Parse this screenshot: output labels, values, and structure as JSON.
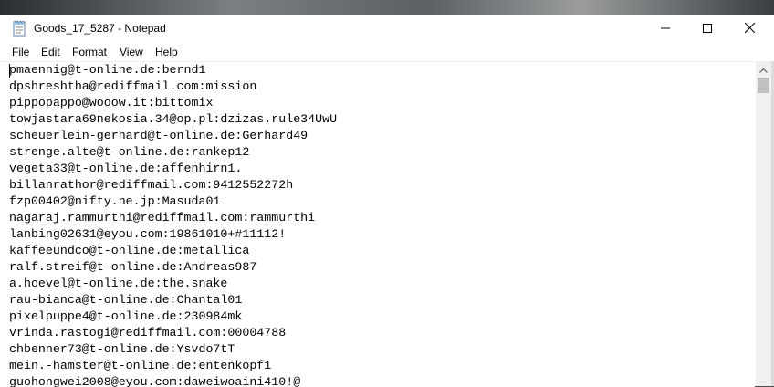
{
  "window": {
    "title": "Goods_17_5287 - Notepad",
    "icon": "notepad-icon"
  },
  "controls": {
    "minimize_icon": "minimize-icon",
    "maximize_icon": "maximize-icon",
    "close_icon": "close-icon"
  },
  "menu": {
    "items": [
      "File",
      "Edit",
      "Format",
      "View",
      "Help"
    ]
  },
  "editor": {
    "lines": [
      "pmaennig@t-online.de:bernd1",
      "dpshreshtha@rediffmail.com:mission",
      "pippopappo@wooow.it:bittomix",
      "towjastara69nekosia.34@op.pl:dzizas.rule34UwU",
      "scheuerlein-gerhard@t-online.de:Gerhard49",
      "strenge.alte@t-online.de:rankep12",
      "vegeta33@t-online.de:affenhirn1.",
      "billanrathor@rediffmail.com:9412552272h",
      "fzp00402@nifty.ne.jp:Masuda01",
      "nagaraj.rammurthi@rediffmail.com:rammurthi",
      "lanbing02631@eyou.com:19861010+#11112!",
      "kaffeeundco@t-online.de:metallica",
      "ralf.streif@t-online.de:Andreas987",
      "a.hoevel@t-online.de:the.snake",
      "rau-bianca@t-online.de:Chantal01",
      "pixelpuppe4@t-online.de:230984mk",
      "vrinda.rastogi@rediffmail.com:00004788",
      "chbenner73@t-online.de:Ysvdo7tT",
      "mein.-hamster@t-online.de:entenkopf1",
      "guohongwei2008@eyou.com:daweiwoaini410!@"
    ]
  },
  "colors": {
    "window_bg": "#ffffff",
    "text": "#000000",
    "scrollbar_track": "#f0f0f0",
    "scrollbar_thumb": "#c1c1c1"
  }
}
